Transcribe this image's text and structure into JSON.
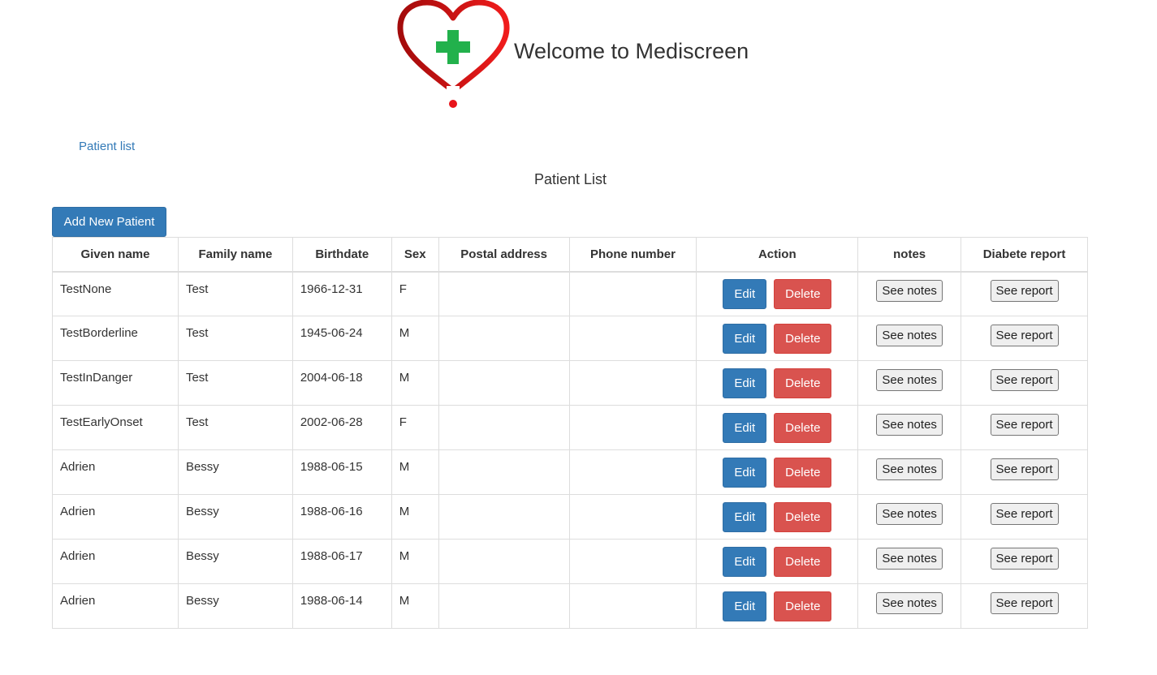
{
  "header": {
    "title": "Welcome to Mediscreen",
    "logo_icon": "heart-medical-cross-icon",
    "colors": {
      "heart": "#d81d1d",
      "cross": "#22b14c"
    }
  },
  "nav": {
    "patient_list_link": "Patient list"
  },
  "page": {
    "heading": "Patient List"
  },
  "toolbar": {
    "add_label": "Add New Patient"
  },
  "table": {
    "columns": [
      "Given name",
      "Family name",
      "Birthdate",
      "Sex",
      "Postal address",
      "Phone number",
      "Action",
      "notes",
      "Diabete report"
    ],
    "action_labels": {
      "edit": "Edit",
      "delete": "Delete",
      "notes": "See notes",
      "report": "See report"
    },
    "rows": [
      {
        "given": "TestNone",
        "family": "Test",
        "birthdate": "1966-12-31",
        "sex": "F",
        "address": "",
        "phone": ""
      },
      {
        "given": "TestBorderline",
        "family": "Test",
        "birthdate": "1945-06-24",
        "sex": "M",
        "address": "",
        "phone": ""
      },
      {
        "given": "TestInDanger",
        "family": "Test",
        "birthdate": "2004-06-18",
        "sex": "M",
        "address": "",
        "phone": ""
      },
      {
        "given": "TestEarlyOnset",
        "family": "Test",
        "birthdate": "2002-06-28",
        "sex": "F",
        "address": "",
        "phone": ""
      },
      {
        "given": "Adrien",
        "family": "Bessy",
        "birthdate": "1988-06-15",
        "sex": "M",
        "address": "",
        "phone": ""
      },
      {
        "given": "Adrien",
        "family": "Bessy",
        "birthdate": "1988-06-16",
        "sex": "M",
        "address": "",
        "phone": ""
      },
      {
        "given": "Adrien",
        "family": "Bessy",
        "birthdate": "1988-06-17",
        "sex": "M",
        "address": "",
        "phone": ""
      },
      {
        "given": "Adrien",
        "family": "Bessy",
        "birthdate": "1988-06-14",
        "sex": "M",
        "address": "",
        "phone": ""
      }
    ]
  }
}
